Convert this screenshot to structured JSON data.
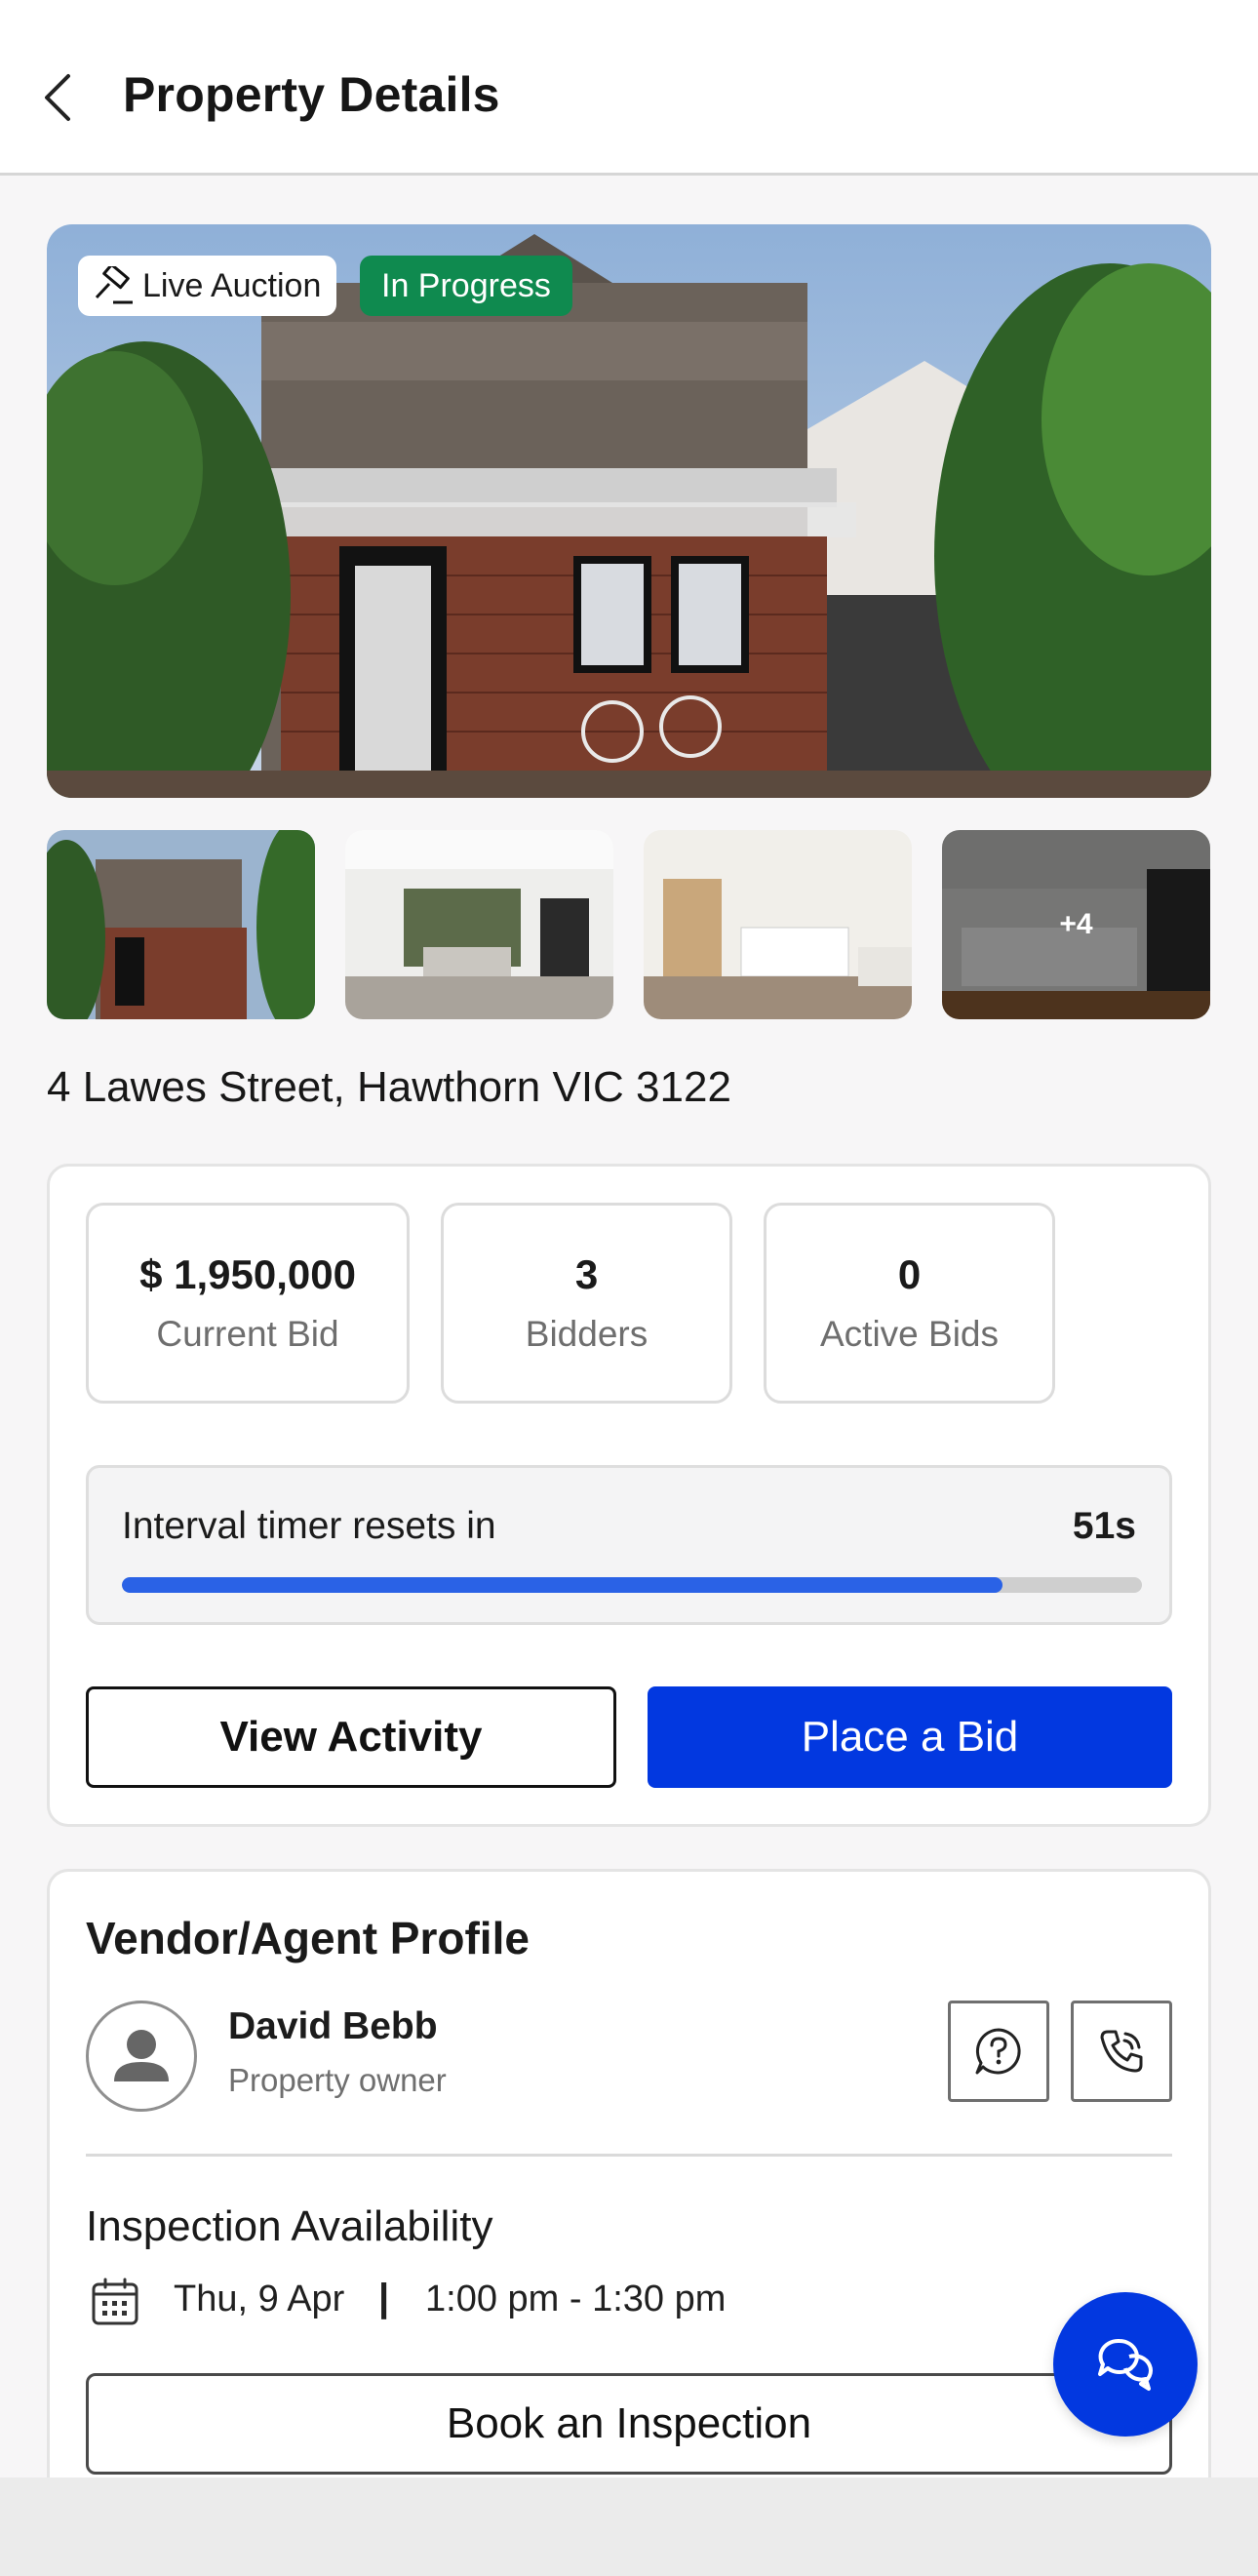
{
  "header": {
    "title": "Property Details"
  },
  "hero": {
    "badge_live": "Live Auction",
    "badge_status": "In Progress"
  },
  "gallery": {
    "more_count": "+4"
  },
  "property": {
    "address": "4 Lawes Street, Hawthorn VIC 3122"
  },
  "auction": {
    "stats": [
      {
        "value": "$ 1,950,000",
        "label": "Current Bid"
      },
      {
        "value": "3",
        "label": "Bidders"
      },
      {
        "value": "0",
        "label": "Active Bids"
      }
    ],
    "timer_label": "Interval timer resets in",
    "timer_value": "51s",
    "timer_progress": 0.863,
    "view_activity_label": "View Activity",
    "place_bid_label": "Place a Bid"
  },
  "vendor": {
    "section_title": "Vendor/Agent Profile",
    "name": "David Bebb",
    "role": "Property owner"
  },
  "inspection": {
    "title": "Inspection Availability",
    "date": "Thu, 9 Apr",
    "separator": "|",
    "time": "1:00 pm - 1:30 pm",
    "book_label": "Book an Inspection"
  },
  "colors": {
    "primary": "#0238e0",
    "status_green": "#0f8a4f",
    "progress_blue": "#2a62e6"
  }
}
